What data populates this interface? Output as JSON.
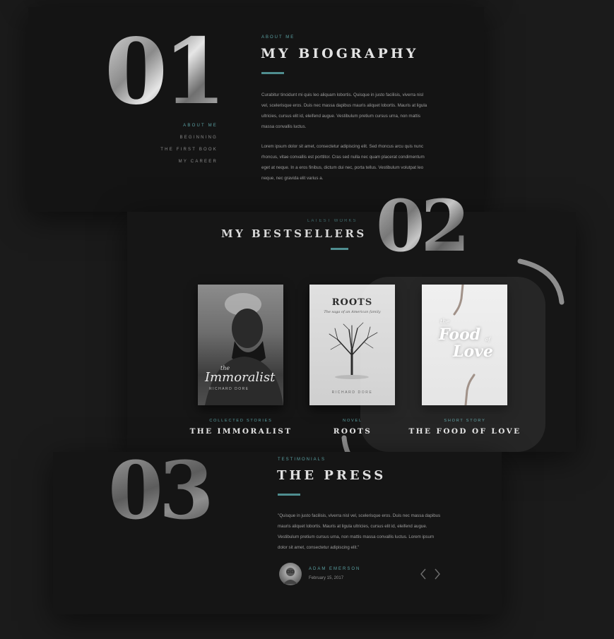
{
  "biography": {
    "number": "01",
    "kicker": "ABOUT ME",
    "title": "MY BIOGRAPHY",
    "paragraph1": "Curabitur tincidunt mi quis leo aliquam lobortis. Quisque in justo facilisis, viverra nisl vel, scelerisque eros. Duis nec massa dapibus mauris aliquet lobortis. Mauris at ligula ultricies, cursus elit id, eleifend augue. Vestibulum pretium cursus urna, non mattis massa convallis luctus.",
    "paragraph2": "Lorem ipsum dolor sit amet, consectetur adipiscing elit. Sed rhoncus arcu quis nunc rhoncus, vitae convallis est porttitor. Cras sed nulla nec quam placerat condimentum eget at neque. In a eros finibus, dictum dui nec, porta tellus. Vestibulum volutpat leo neque, nec gravida elit varius a.",
    "nav": [
      "ABOUT ME",
      "BEGINNING",
      "THE FIRST BOOK",
      "MY CAREER"
    ]
  },
  "bestsellers": {
    "number": "02",
    "kicker": "LATEST WORKS",
    "title": "MY BESTSELLERS",
    "books": [
      {
        "category": "COLLECTED STORIES",
        "title": "THE IMMORALIST",
        "cover_small": "the",
        "cover_title": "Immoralist",
        "cover_author": "RICHARD DORE"
      },
      {
        "category": "NOVEL",
        "title": "ROOTS",
        "cover_title": "ROOTS",
        "cover_subtitle": "The saga of an American family",
        "cover_author": "RICHARD DORE"
      },
      {
        "category": "SHORT STORY",
        "title": "THE FOOD OF LOVE",
        "cover_small": "the",
        "cover_title_a": "Food",
        "cover_small2": "of",
        "cover_title_b": "Love"
      }
    ]
  },
  "press": {
    "number": "03",
    "kicker": "TESTIMONIALS",
    "title": "THE PRESS",
    "quote": "\"Quisque in justo facilisis, viverra nisl vel, scelerisque eros. Duis nec massa dapibus mauris aliquet lobortis. Mauris at ligula ultricies, cursus elit id, eleifend augue. Vestibulum pretium cursus urna, non mattis massa convallis luctus. Lorem ipsum dolor sit amet, consectetur adipiscing elit.\"",
    "author": "ADAM EMERSON",
    "date": "February 15, 2017",
    "prev_icon": "chevron-left-icon",
    "next_icon": "chevron-right-icon"
  },
  "colors": {
    "accent": "#5aa0a2",
    "background": "#1b1b1b",
    "card": "#141414"
  }
}
